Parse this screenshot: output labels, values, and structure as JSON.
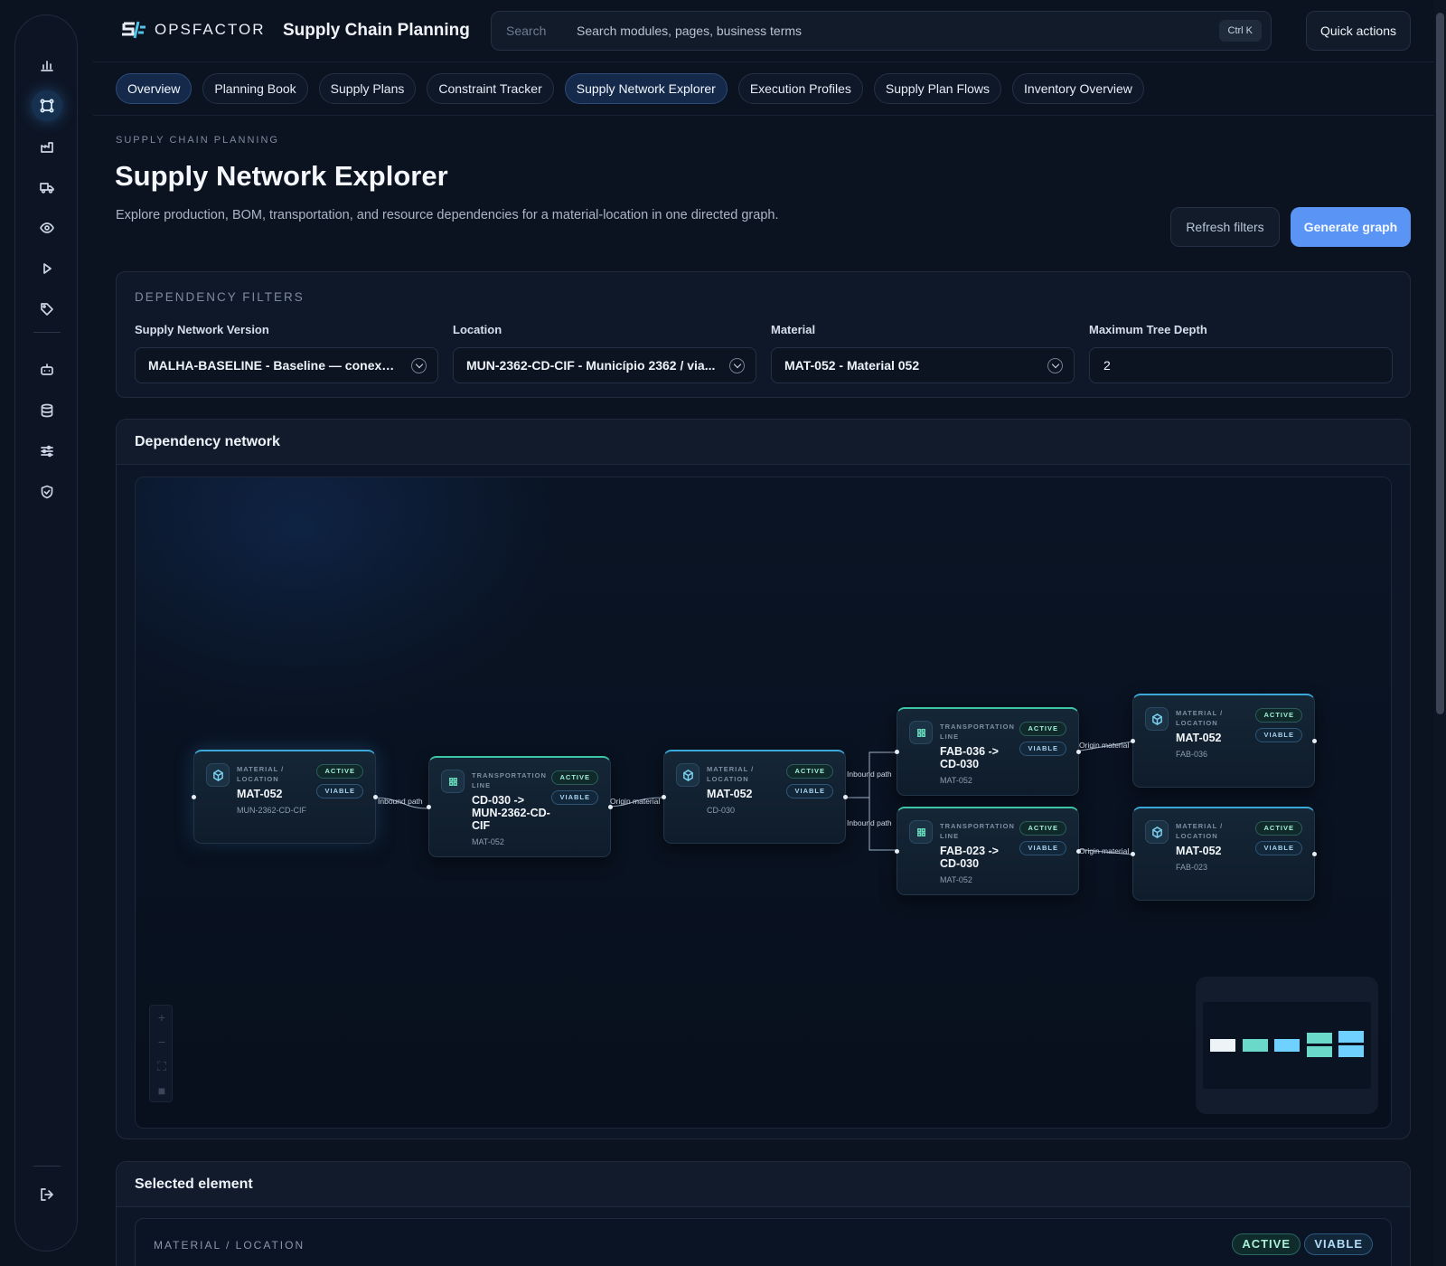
{
  "brand": {
    "name": "OPSFACTOR",
    "app_title": "Supply Chain Planning"
  },
  "search": {
    "label": "Search",
    "placeholder": "Search modules, pages, business terms",
    "shortcut": "Ctrl K"
  },
  "quick_actions": "Quick actions",
  "tabs": [
    "Overview",
    "Planning Book",
    "Supply Plans",
    "Constraint Tracker",
    "Supply Network Explorer",
    "Execution Profiles",
    "Supply Plan Flows",
    "Inventory Overview"
  ],
  "page": {
    "eyebrow": "SUPPLY CHAIN PLANNING",
    "title": "Supply Network Explorer",
    "description": "Explore production, BOM, transportation, and resource dependencies for a material-location in one directed graph.",
    "refresh": "Refresh filters",
    "generate": "Generate graph"
  },
  "filters": {
    "title": "DEPENDENCY FILTERS",
    "version_label": "Supply Network Version",
    "version_value": "MALHA-BASELINE - Baseline — conexões...",
    "location_label": "Location",
    "location_value": "MUN-2362-CD-CIF - Município 2362 / via...",
    "material_label": "Material",
    "material_value": "MAT-052 - Material 052",
    "depth_label": "Maximum Tree Depth",
    "depth_value": "2"
  },
  "network": {
    "title": "Dependency network",
    "status_active": "ACTIVE",
    "status_viable": "VIABLE",
    "nodes": [
      {
        "kind": "MATERIAL / LOCATION",
        "title": "MAT-052",
        "sub": "MUN-2362-CD-CIF"
      },
      {
        "kind": "TRANSPORTATION LINE",
        "title": "CD-030 -> MUN-2362-CD-CIF",
        "sub": "MAT-052"
      },
      {
        "kind": "MATERIAL / LOCATION",
        "title": "MAT-052",
        "sub": "CD-030"
      },
      {
        "kind": "TRANSPORTATION LINE",
        "title": "FAB-036 -> CD-030",
        "sub": "MAT-052"
      },
      {
        "kind": "TRANSPORTATION LINE",
        "title": "FAB-023 -> CD-030",
        "sub": "MAT-052"
      },
      {
        "kind": "MATERIAL / LOCATION",
        "title": "MAT-052",
        "sub": "FAB-036"
      },
      {
        "kind": "MATERIAL / LOCATION",
        "title": "MAT-052",
        "sub": "FAB-023"
      }
    ],
    "edges": [
      "Inbound path",
      "Origin material",
      "Inbound path",
      "Inbound path",
      "Origin material",
      "Origin material"
    ]
  },
  "selected": {
    "title": "Selected element",
    "kind": "MATERIAL / LOCATION",
    "status_active": "ACTIVE",
    "status_viable": "VIABLE"
  }
}
